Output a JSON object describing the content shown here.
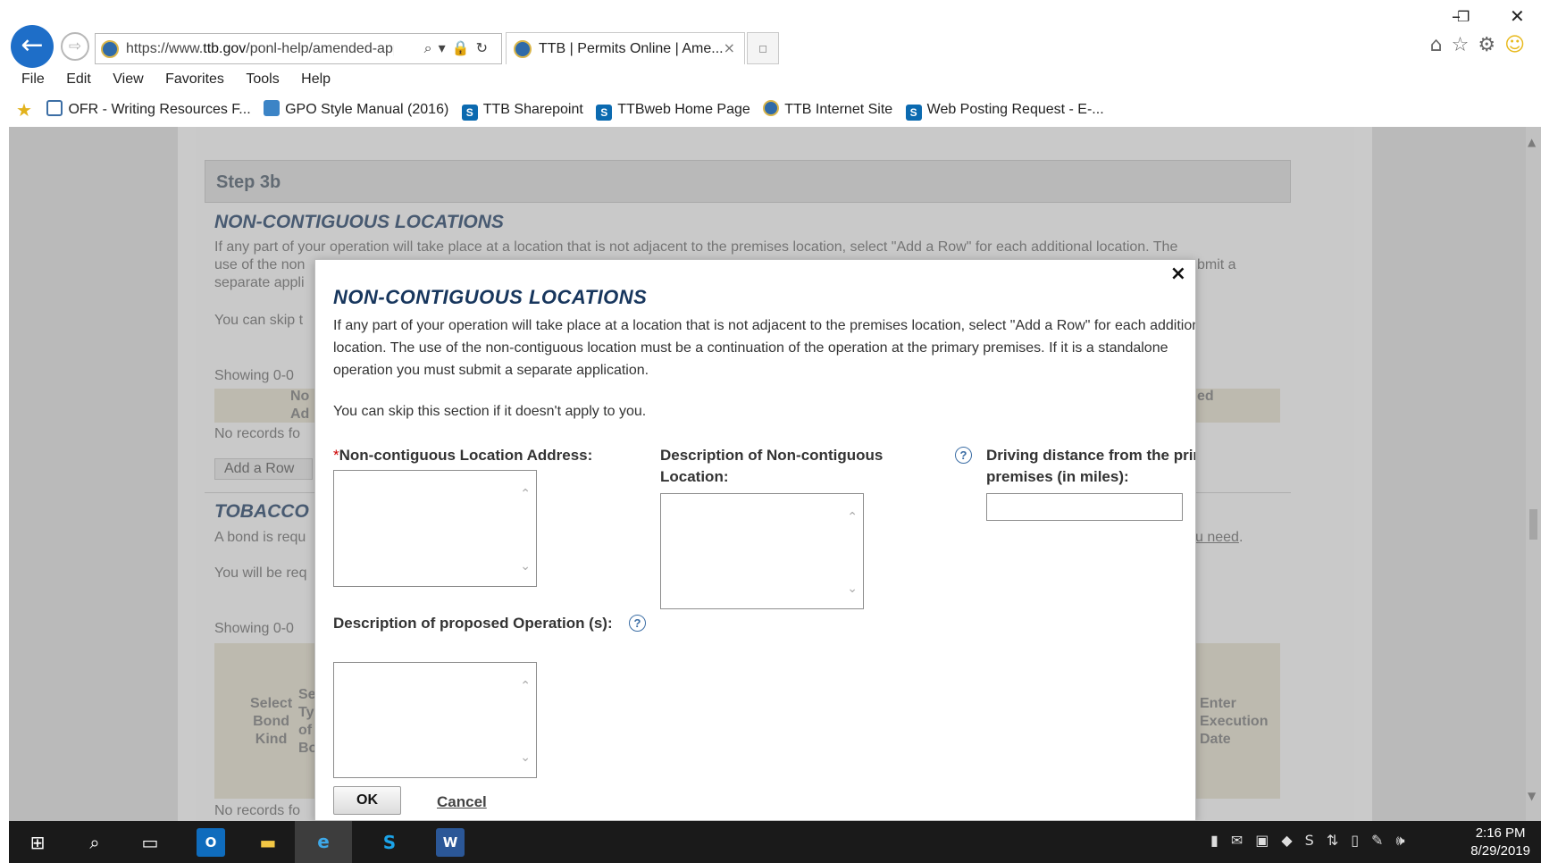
{
  "browser": {
    "url_prefix": "https://www.",
    "url_domain": "ttb.gov",
    "url_path": "/ponl-help/amended-app",
    "tab_title": "TTB | Permits Online | Ame...",
    "tab_close": "×",
    "back_glyph": "←",
    "forward_glyph": "⇨",
    "address_tools": "⌕▾🔒↻",
    "new_tab_glyph": "▫",
    "right_icons": [
      "home-icon",
      "favorites-star-icon",
      "settings-gear-icon",
      "feedback-smiley-icon"
    ],
    "window_controls": {
      "minimize": "–",
      "restore": "❐",
      "close": "✕"
    }
  },
  "menu": [
    "File",
    "Edit",
    "View",
    "Favorites",
    "Tools",
    "Help"
  ],
  "favorites": [
    {
      "label": "OFR - Writing Resources F...",
      "icon": "page"
    },
    {
      "label": "GPO Style Manual (2016)",
      "icon": "gpo"
    },
    {
      "label": "TTB Sharepoint",
      "icon": "sp"
    },
    {
      "label": "TTBweb Home Page",
      "icon": "sp"
    },
    {
      "label": "TTB Internet Site",
      "icon": "ttb"
    },
    {
      "label": "Web Posting Request - E-...",
      "icon": "sp"
    }
  ],
  "background_page": {
    "step": "Step 3b",
    "section1_title": "NON-CONTIGUOUS LOCATIONS",
    "section1_text_line1": "If any part of your operation will take place at a location that is not adjacent to the premises location, select \"Add a Row\" for each additional location. The",
    "section1_text_line2a": "use of the non",
    "section1_text_line2b": "bmit a",
    "section1_text_line3": "separate appli",
    "skip_fragment": "You can skip t",
    "showing1": "Showing 0-0",
    "header_frag1": "No",
    "header_frag2": "Ad",
    "header_frag_right": "ed",
    "no_records1": "No records fo",
    "add_row": "Add a Row",
    "section2_title": "TOBACCO",
    "bond_text": "A bond is requ",
    "need_link": "u need",
    "need_period": ".",
    "will_be": "You will be req",
    "showing2": "Showing 0-0",
    "col_select": "Select\nBond\nKind",
    "col_select2": "Se\nTy\nof\nBo",
    "col_enter": "Enter\nExecution\nDate",
    "no_records2": "No records fo"
  },
  "modal": {
    "close": "×",
    "title": "NON-CONTIGUOUS LOCATIONS",
    "intro": "If any part of your operation will take place at a location that is not adjacent to the premises location, select \"Add a Row\" for each additional location. The use of the non-contiguous location must be a continuation of the operation at the primary premises. If it is a standalone operation you must submit a separate application.",
    "skip": "You can skip this section if it doesn't apply to you.",
    "address_label": "Non-contiguous Location Address:",
    "required_mark": "*",
    "description_label": "Description of Non-contiguous Location:",
    "distance_label": "Driving distance from the primary premises (in miles):",
    "operation_label": "Description of proposed Operation (s):",
    "help_glyph": "?",
    "scroll_up": "⌃",
    "scroll_down": "⌄",
    "address_value": "",
    "description_value": "",
    "distance_value": "",
    "operation_value": "",
    "ok": "OK",
    "cancel": "Cancel"
  },
  "taskbar": {
    "time": "2:16 PM",
    "date": "8/29/2019",
    "apps": [
      "windows-start-icon",
      "search-icon",
      "task-view-icon",
      "outlook-icon",
      "file-explorer-icon",
      "internet-explorer-icon",
      "skype-icon",
      "word-icon"
    ]
  },
  "colors": {
    "accent_blue": "#1e6ec8",
    "title_navy": "#17365d",
    "overlay": "#808080"
  }
}
